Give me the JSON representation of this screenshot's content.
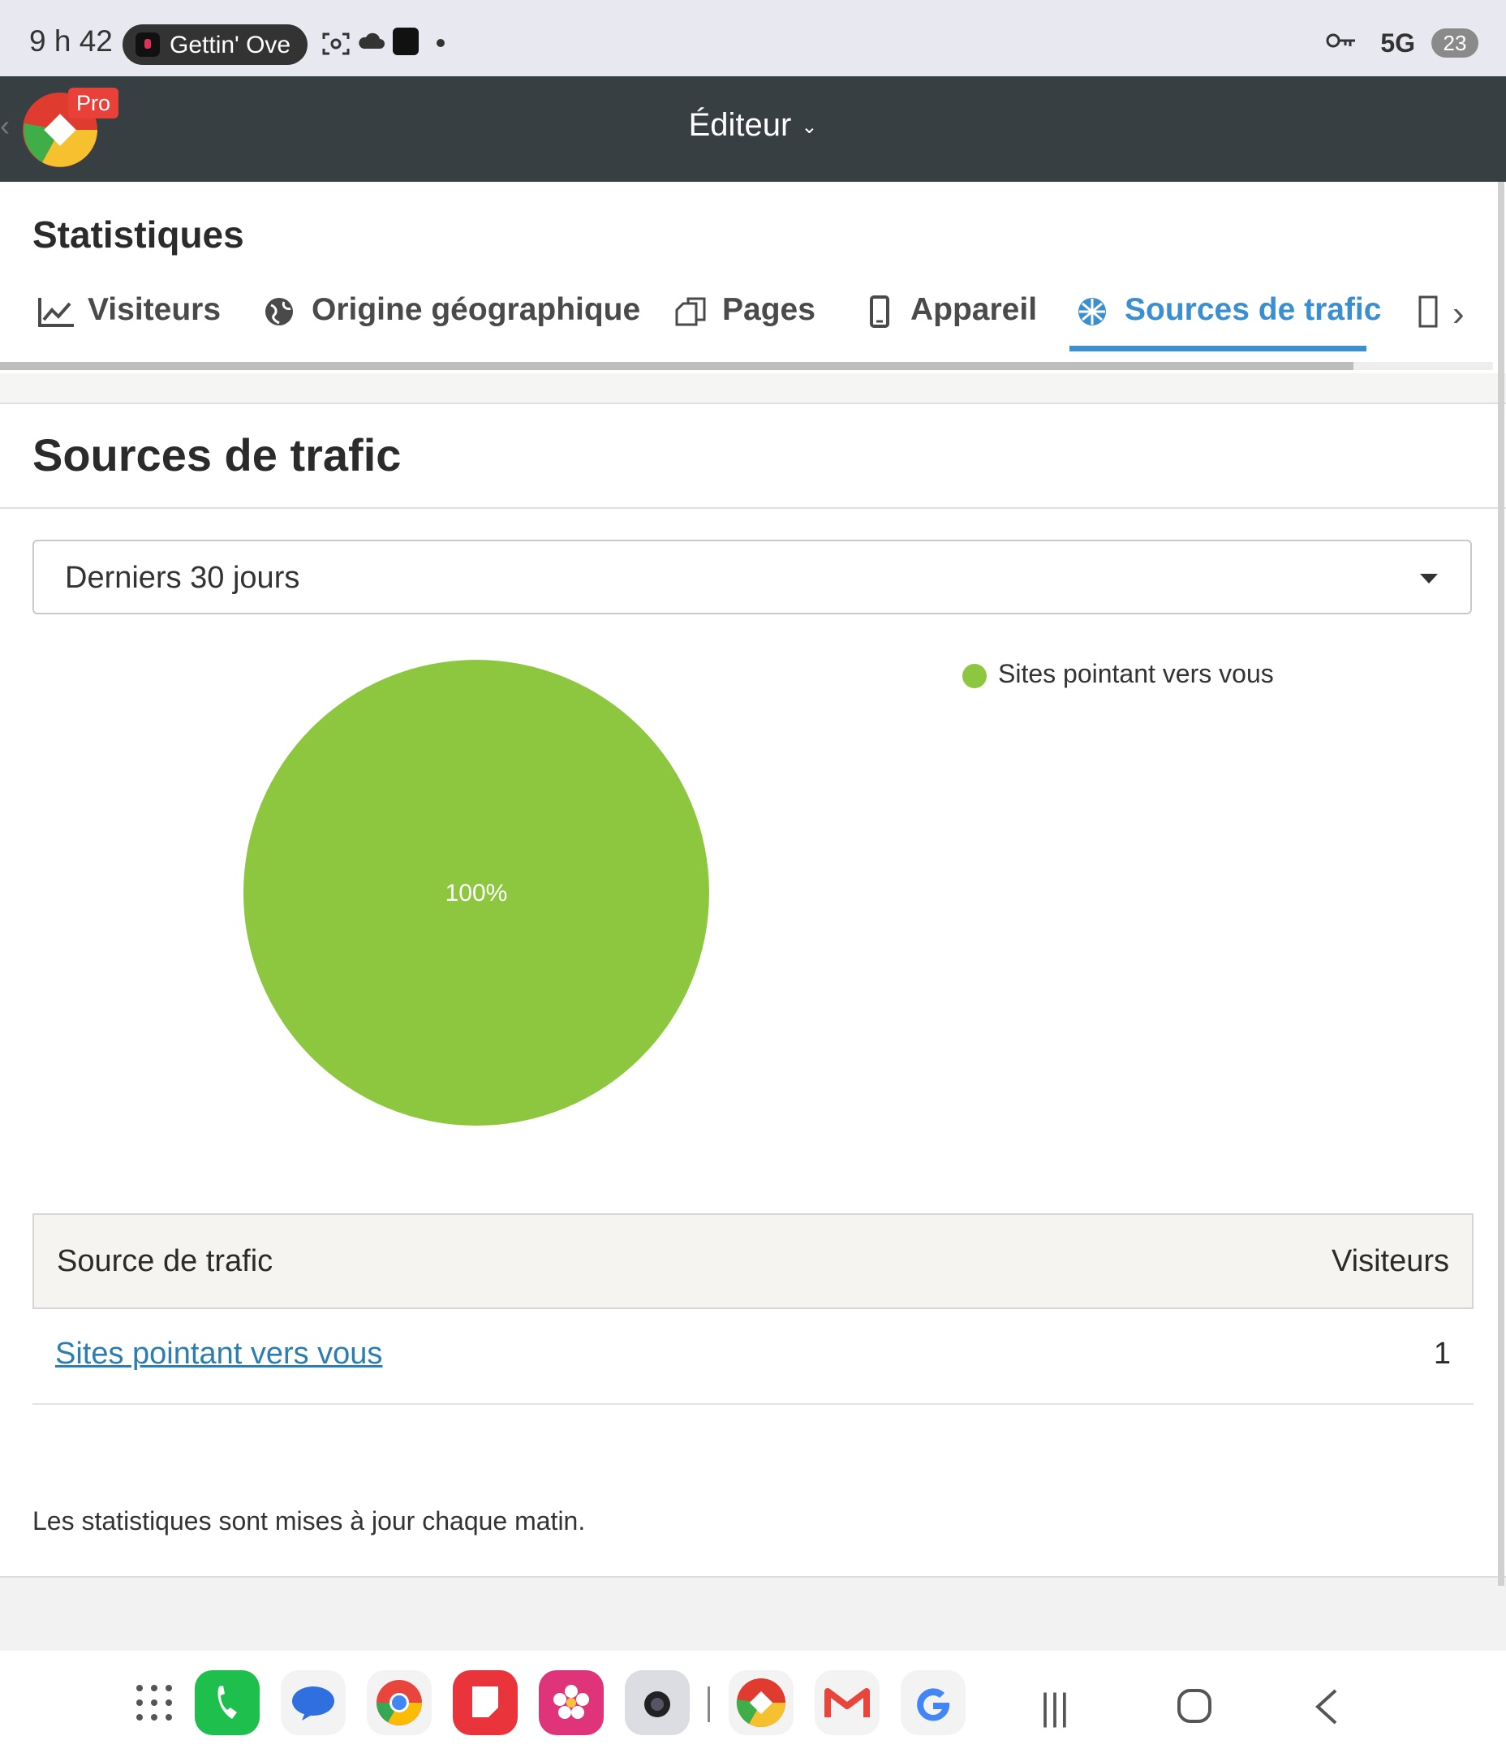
{
  "status_bar": {
    "time": "9 h 42",
    "media_title": "Gettin' Ove",
    "network": "5G",
    "battery": "23"
  },
  "app_bar": {
    "badge": "Pro",
    "title": "Éditeur"
  },
  "page": {
    "title": "Statistiques",
    "tabs": [
      {
        "label": "Visiteurs",
        "icon": "line-chart-icon",
        "active": false
      },
      {
        "label": "Origine géographique",
        "icon": "globe-icon",
        "active": false
      },
      {
        "label": "Pages",
        "icon": "pages-icon",
        "active": false
      },
      {
        "label": "Appareil",
        "icon": "phone-icon",
        "active": false
      },
      {
        "label": "Sources de trafic",
        "icon": "traffic-icon",
        "active": true
      }
    ]
  },
  "section": {
    "title": "Sources de trafic",
    "period": "Derniers 30 jours"
  },
  "chart_data": {
    "type": "pie",
    "categories": [
      "Sites pointant vers vous"
    ],
    "values": [
      100
    ],
    "labels": [
      "100%"
    ],
    "colors": [
      "#8dc63f"
    ],
    "legend": "top-right"
  },
  "table": {
    "headers": {
      "source": "Source de trafic",
      "visitors": "Visiteurs"
    },
    "rows": [
      {
        "source": "Sites pointant vers vous",
        "visitors": "1"
      }
    ]
  },
  "footer_note": "Les statistiques sont mises à jour chaque matin.",
  "colors": {
    "accent": "#3b8fcf",
    "app_bar": "#383f43",
    "pie_green": "#8dc63f",
    "link": "#2d7eb0"
  },
  "dock": {
    "apps": [
      "apps-grid-icon",
      "phone-app-icon",
      "messages-app-icon",
      "chrome-app-icon",
      "notes-app-icon",
      "gallery-app-icon",
      "camera-app-icon",
      "sitebuilder-app-icon",
      "gmail-app-icon",
      "google-app-icon"
    ],
    "nav": [
      "recents-icon",
      "home-icon",
      "back-icon"
    ]
  }
}
